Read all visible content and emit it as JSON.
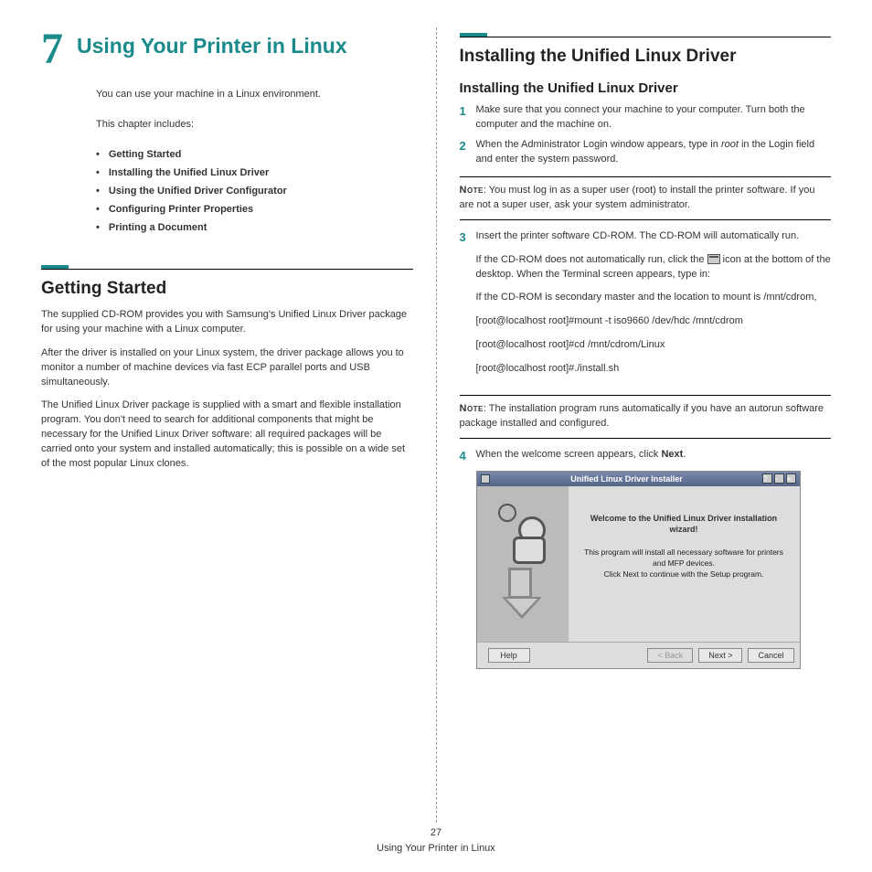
{
  "chapter": {
    "number": "7",
    "title": "Using Your Printer in Linux"
  },
  "intro": "You can use your machine in a Linux environment.",
  "includes_label": "This chapter includes:",
  "toc": [
    "Getting Started",
    "Installing the Unified Linux Driver",
    "Using the Unified Driver Configurator",
    "Configuring Printer Properties",
    "Printing a Document"
  ],
  "getting_started": {
    "title": "Getting Started",
    "p1": "The supplied CD-ROM provides you with Samsung's Unified Linux Driver package for using your machine with a Linux computer.",
    "p2": "After the driver is installed on your Linux system, the driver package allows you to monitor a number of machine devices via fast ECP parallel ports and USB simultaneously.",
    "p3": "The Unified Linux Driver package is supplied with a smart and flexible installation program. You don't need to search for additional components that might be necessary for the Unified Linux Driver software: all required packages will be carried onto your system and installed automatically; this is possible on a wide set of the most popular Linux clones."
  },
  "install": {
    "title": "Installing the Unified Linux Driver",
    "subtitle": "Installing the Unified Linux Driver",
    "step1": "Make sure that you connect your machine to your computer. Turn both the computer and the machine on.",
    "step2_a": "When the Administrator Login window appears, type in ",
    "step2_root": "root",
    "step2_b": " in the Login field and enter the system password.",
    "note1_label": "Note",
    "note1": ": You must log in as a super user (root) to install the printer software. If you are not a super user, ask your system administrator.",
    "step3": "Insert the printer software CD-ROM. The CD-ROM will automatically run.",
    "step3_sub1a": "If the CD-ROM does not automatically run, click the ",
    "step3_sub1b": " icon at the bottom of the desktop. When the Terminal screen appears, type in:",
    "step3_sub2": "If the CD-ROM is secondary master and the location to mount is /mnt/cdrom,",
    "step3_cmd1": "[root@localhost root]#mount -t iso9660 /dev/hdc /mnt/cdrom",
    "step3_cmd2": "[root@localhost root]#cd /mnt/cdrom/Linux",
    "step3_cmd3": "[root@localhost root]#./install.sh",
    "note2_label": "Note",
    "note2": ": The installation program runs automatically if you have an autorun software package installed and configured.",
    "step4_a": "When the welcome screen appears, click ",
    "step4_next": "Next",
    "step4_b": "."
  },
  "screenshot": {
    "title": "Unified Linux Driver Installer",
    "welcome": "Welcome to the Unified Linux Driver installation wizard!",
    "desc1": "This program will install all necessary software for printers and MFP devices.",
    "desc2": "Click Next to continue with the Setup program.",
    "help": "Help",
    "back": "< Back",
    "next": "Next >",
    "cancel": "Cancel"
  },
  "footer": {
    "page": "27",
    "title": "Using Your Printer in Linux"
  }
}
